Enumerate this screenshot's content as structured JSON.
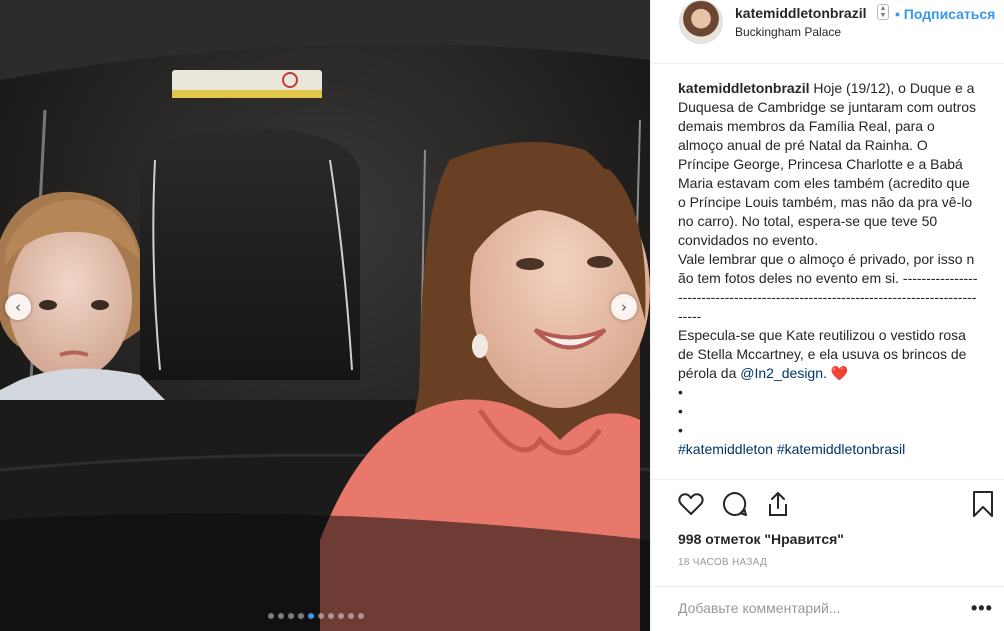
{
  "post": {
    "username": "katemiddletonbrazil",
    "follow_label": "• Подписаться",
    "location": "Buckingham Palace",
    "caption": {
      "username": "katemiddletonbrazil",
      "text": "Hoje (19/12), o Duque e a Duquesa de Cambridge se juntaram com outros demais membros da Família Real, para o almoço anual de pré Natal da Rainha. O Príncipe George, Princesa Charlotte e a Babá Maria estavam com eles também (acredito que o Príncipe Louis também, mas não da pra vê-lo no carro). No total, espera-se que teve 50 convidados no evento.",
      "para2": "Vale lembrar que o almoço é privado, por isso não tem fotos deles no evento em si. -------------------------------------------------------------------------------------",
      "para3_a": "Especula-se que Kate reutilizou o vestido rosa de Stella Mccartney, e ela usuva os brincos de pérola da ",
      "mention": "@In2_design",
      "para3_b": ". ❤️",
      "bullet1": "•",
      "bullet2": "•",
      "bullet3": "•",
      "hashtag1": "#katemiddleton",
      "hashtag2": "#katemiddletonbrasil"
    },
    "likes": "998 отметок \"Нравится\"",
    "time": "18 ЧАСОВ НАЗАД",
    "comment_placeholder": "Добавьте комментарий...",
    "more_label": "•••"
  },
  "carousel": {
    "prev_label": "‹",
    "next_label": "›",
    "total": 10,
    "active_index": 4
  },
  "icons": {
    "like": "heart-icon",
    "comment": "comment-icon",
    "share": "share-icon",
    "save": "bookmark-icon",
    "verified": "sort-icon"
  },
  "colors": {
    "accent": "#3897f0",
    "text": "#262626",
    "muted": "#999999",
    "link": "#003569",
    "dress": "#e8786c"
  }
}
